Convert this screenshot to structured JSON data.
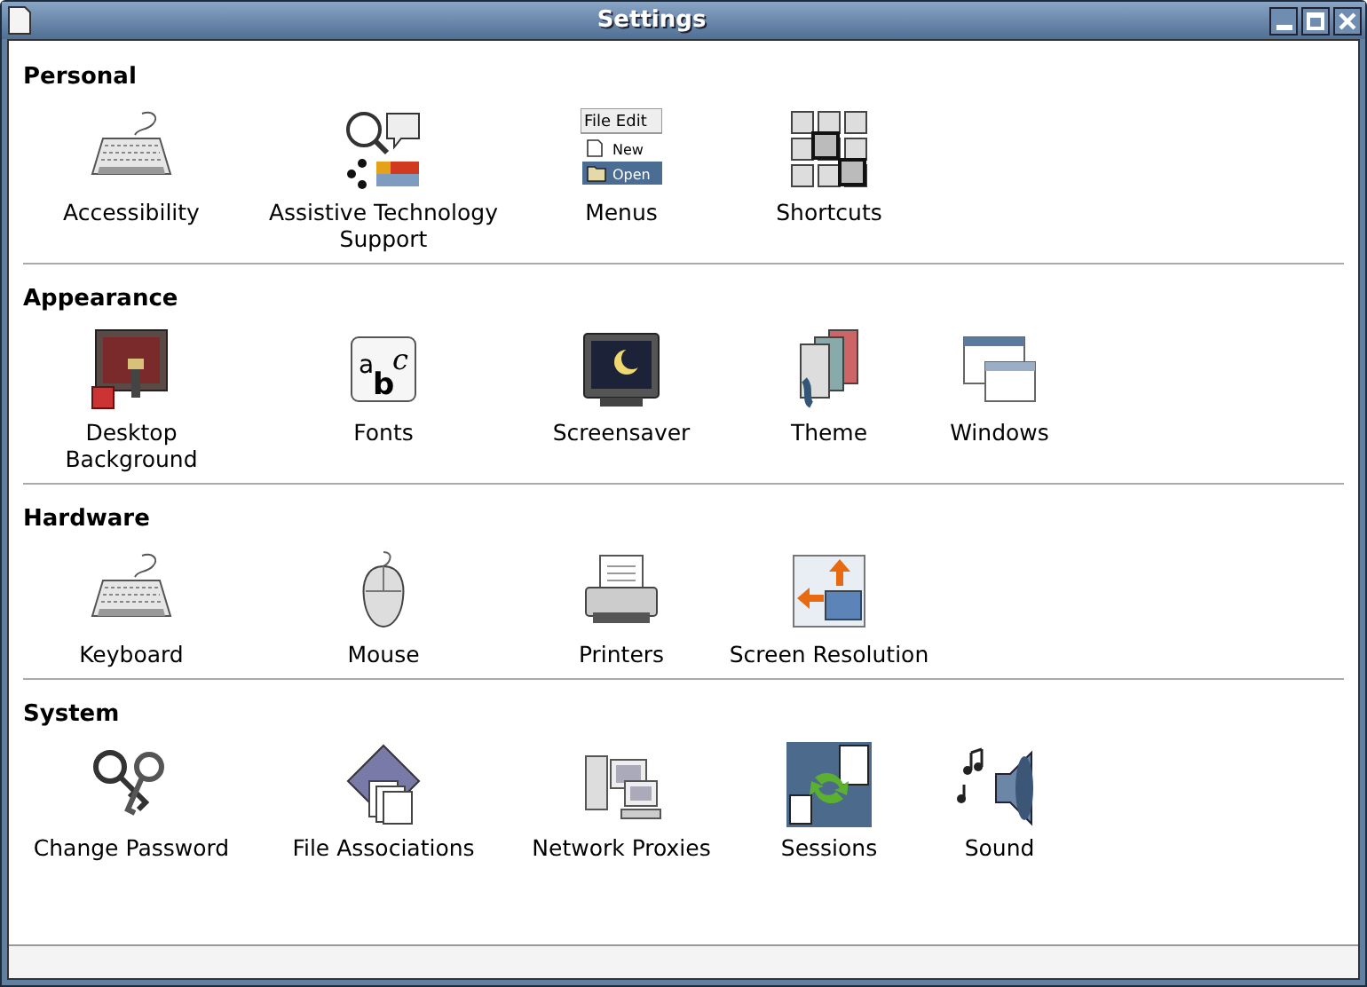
{
  "window": {
    "title": "Settings"
  },
  "sections": [
    {
      "title": "Personal",
      "items": [
        {
          "label": "Accessibility",
          "kind": "keyboard"
        },
        {
          "label": "Assistive Technology Support",
          "kind": "assistive"
        },
        {
          "label": "Menus",
          "kind": "menus",
          "menubar": [
            "File",
            "Edit"
          ],
          "entries": [
            "New",
            "Open"
          ]
        },
        {
          "label": "Shortcuts",
          "kind": "shortcuts"
        }
      ]
    },
    {
      "title": "Appearance",
      "items": [
        {
          "label": "Desktop Background",
          "kind": "background"
        },
        {
          "label": "Fonts",
          "kind": "fonts",
          "sample": [
            "a",
            "b",
            "c"
          ]
        },
        {
          "label": "Screensaver",
          "kind": "screensaver"
        },
        {
          "label": "Theme",
          "kind": "theme"
        },
        {
          "label": "Windows",
          "kind": "windows"
        }
      ]
    },
    {
      "title": "Hardware",
      "items": [
        {
          "label": "Keyboard",
          "kind": "keyboard"
        },
        {
          "label": "Mouse",
          "kind": "mouse"
        },
        {
          "label": "Printers",
          "kind": "printer"
        },
        {
          "label": "Screen Resolution",
          "kind": "resolution"
        }
      ]
    },
    {
      "title": "System",
      "items": [
        {
          "label": "Change Password",
          "kind": "keys"
        },
        {
          "label": "File Associations",
          "kind": "files"
        },
        {
          "label": "Network Proxies",
          "kind": "network"
        },
        {
          "label": "Sessions",
          "kind": "sessions"
        },
        {
          "label": "Sound",
          "kind": "sound"
        }
      ]
    }
  ]
}
